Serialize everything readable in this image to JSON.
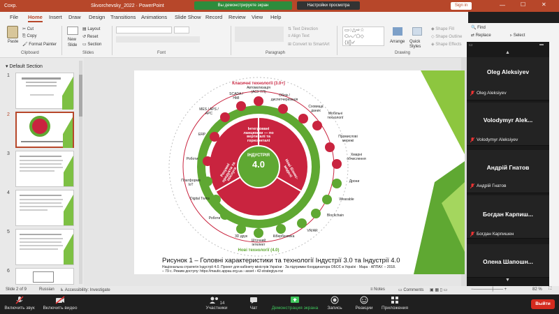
{
  "app": {
    "autosave": "Сохр.",
    "title": "Skvorchevsky_2022  ·  PowerPoint",
    "share_banner": "Вы демонстрируете экран",
    "share_settings": "Настройки просмотра",
    "sign_in": "Sign in"
  },
  "tabs": [
    "File",
    "Home",
    "Insert",
    "Draw",
    "Design",
    "Transitions",
    "Animations",
    "Slide Show",
    "Record",
    "Review",
    "View",
    "Help"
  ],
  "active_tab": "Home",
  "ribbon": {
    "paste": "Paste",
    "cut": "Cut",
    "copy": "Copy",
    "format_painter": "Format Painter",
    "new_slide_1": "New",
    "new_slide_2": "Slide",
    "layout": "Layout",
    "reset": "Reset",
    "section": "Section",
    "text_direction": "Text Direction",
    "align_text": "Align Text",
    "convert_smartart": "Convert to SmartArt",
    "arrange": "Arrange",
    "quick_styles": "Quick Styles",
    "shape_fill": "Shape Fill",
    "shape_outline": "Shape Outline",
    "shape_effects": "Shape Effects",
    "find": "Find",
    "replace": "Replace",
    "select": "Select",
    "group_clipboard": "Clipboard",
    "group_slides": "Slides",
    "group_font": "Font",
    "group_paragraph": "Paragraph",
    "group_drawing": "Drawing"
  },
  "thumbs": {
    "section": "Default Section",
    "numbers": [
      "1",
      "2",
      "3",
      "4",
      "5",
      "6"
    ]
  },
  "slide": {
    "top_title": "Класичні технології (3.0+)",
    "center_title": "ІНДУСТРІЯ",
    "center_num": "4.0",
    "seg_top": "Інтегровані ланцюжки — по вертикалі та горизонталі",
    "seg_left": "Розумні продукти та послуги",
    "seg_right": "Нові бізнес-моделі",
    "bottom_title": "Нові технології (4.0)",
    "techs": [
      "Автоматизація (АСУ ТП)",
      "Облік / диспетчеризація",
      "Сховища даних",
      "Мобільні технології",
      "Промислові мережі",
      "Хмарні обчислення",
      "Дрони",
      "Wearable",
      "Blockchain",
      "VR/AR",
      "Кібербезпека",
      "Штучний інтелект",
      "3D друк",
      "Роботи",
      "Digital Twins",
      "Платформи IoT",
      "Роботи",
      "ERP",
      "MES / APS / APC",
      "SCADA / HMI"
    ],
    "caption": "Рисунок 1 – Головні характеристики та технології Індустрії 3.0 та Індустрії 4.0",
    "source_line1": "Національна стратегія Індустрії 4.0. Проект для кабінету міністрів України · За підтримки Координатора ОБСЄ в Україні · Mapa · АППАУ. – 2018.",
    "source_line2": "– 79 с. Режим доступу: https://mautic.appau.org.ua › asset › 42-strategiya-roz"
  },
  "status": {
    "slide": "Slide 2 of 9",
    "lang": "Russian",
    "accessibility": "Accessibility: Investigate",
    "notes": "Notes",
    "comments": "Comments",
    "zoom": "82 %"
  },
  "meeting": {
    "mic": "Включить звук",
    "video": "Включить видео",
    "participants": "Участники",
    "participants_count": "14",
    "chat": "Чат",
    "share": "Демонстрация экрана",
    "record": "Запись",
    "reactions": "Реакции",
    "apps": "Приложения",
    "leave": "Выйти"
  },
  "participants": [
    {
      "name": "Oleg Aleksiyev",
      "label": "Oleg Aleksiyev"
    },
    {
      "name": "Volodymyr Alek...",
      "label": "Volodymyr Aleksiyev"
    },
    {
      "name": "Андрій Гнатов",
      "label": "Андрій Гнатов"
    },
    {
      "name": "Богдан Карпиш...",
      "label": "Богдан Карпишен"
    },
    {
      "name": "Олена Шапошн...",
      "label": ""
    }
  ],
  "colors": {
    "accent": "#b7472a",
    "green": "#5fa832",
    "crimson": "#c9243f",
    "leave": "#d52b1e"
  }
}
